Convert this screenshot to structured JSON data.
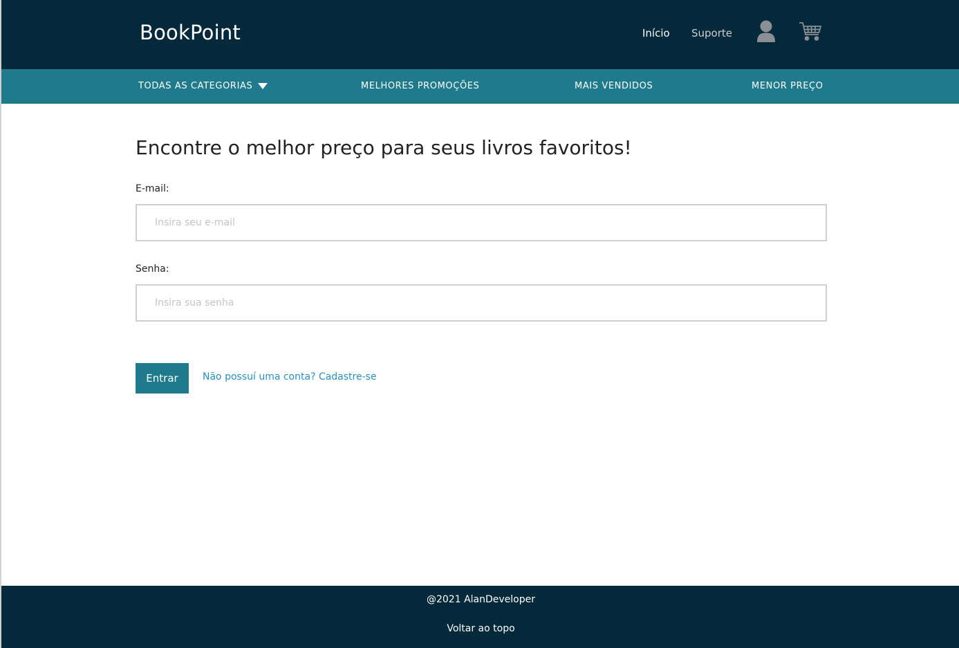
{
  "header": {
    "logo": "BookPoint",
    "nav": {
      "home": "Início",
      "support": "Suporte"
    },
    "icons": {
      "user": "user-icon",
      "cart": "cart-icon"
    }
  },
  "categories": {
    "all": "TODAS AS CATEGORIAS",
    "promotions": "MELHORES PROMOÇÕES",
    "bestsellers": "MAIS VENDIDOS",
    "lowest_price": "MENOR PREÇO"
  },
  "main": {
    "headline": "Encontre o melhor preço para seus livros favoritos!",
    "email": {
      "label": "E-mail:",
      "placeholder": "Insira seu e-mail",
      "value": ""
    },
    "password": {
      "label": "Senha:",
      "placeholder": "Insira sua senha",
      "value": ""
    },
    "submit_label": "Entrar",
    "signup_link": "Não possuí uma conta? Cadastre-se"
  },
  "footer": {
    "copyright": "@2021 AlanDeveloper",
    "back_to_top": "Voltar ao topo"
  },
  "colors": {
    "header_bg": "#03293a",
    "category_bar_bg": "#1f7a8c",
    "accent": "#1f7a8c",
    "link": "#2a8fc2"
  }
}
